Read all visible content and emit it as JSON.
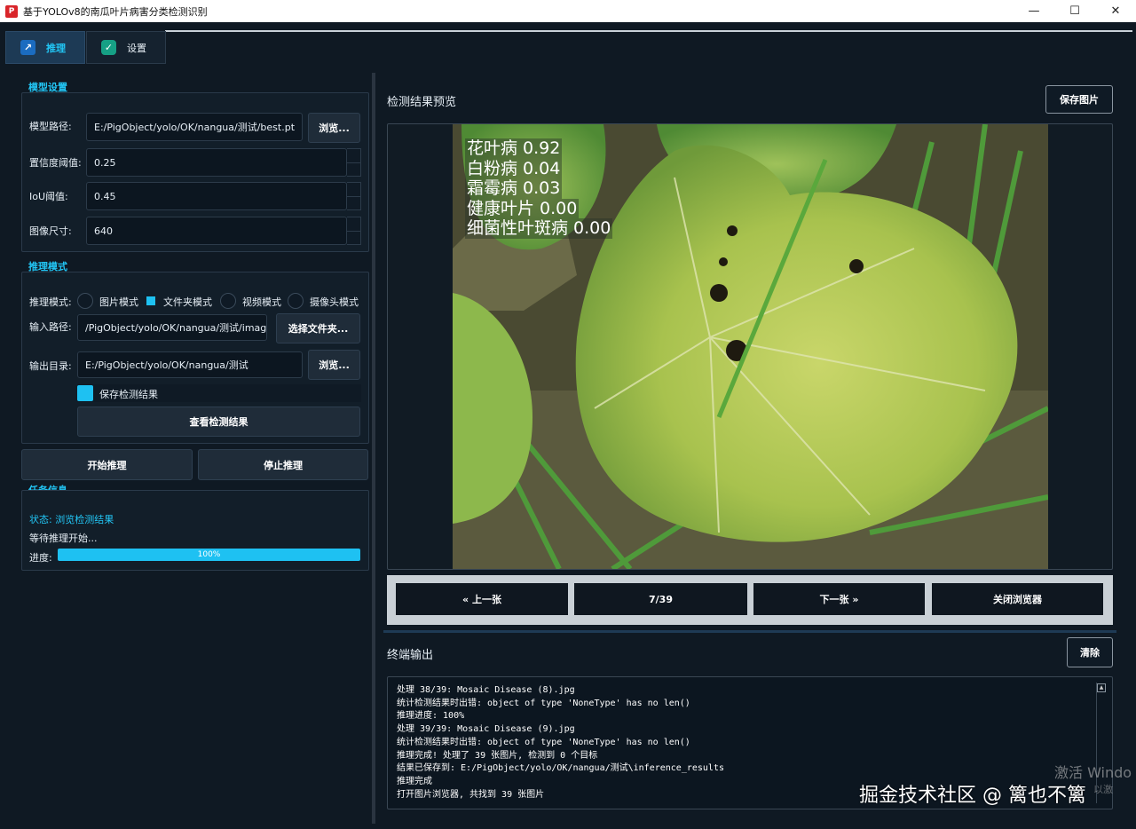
{
  "window": {
    "title": "基于YOLOv8的南瓜叶片病害分类检测识别",
    "minimize": "—",
    "maximize": "☐",
    "close": "✕"
  },
  "tabs": [
    {
      "label": "推理",
      "icon": "chart-icon",
      "active": true
    },
    {
      "label": "设置",
      "icon": "check-icon",
      "active": false
    }
  ],
  "model_settings": {
    "section_title": "模型设置",
    "model_path_label": "模型路径:",
    "model_path_value": "E:/PigObject/yolo/OK/nangua/测试/best.pt",
    "browse_label": "浏览...",
    "conf_label": "置信度阈值:",
    "conf_value": "0.25",
    "iou_label": "IoU阈值:",
    "iou_value": "0.45",
    "imgsz_label": "图像尺寸:",
    "imgsz_value": "640"
  },
  "inference_mode": {
    "section_title": "推理模式",
    "mode_label": "推理模式:",
    "modes": [
      "图片模式",
      "文件夹模式",
      "视频模式",
      "摄像头模式"
    ],
    "selected_mode": "文件夹模式",
    "input_label": "输入路径:",
    "input_value": "/PigObject/yolo/OK/nangua/测试/image",
    "select_folder_label": "选择文件夹...",
    "output_label": "输出目录:",
    "output_value": "E:/PigObject/yolo/OK/nangua/测试",
    "browse_label": "浏览...",
    "save_results_label": "保存检测结果",
    "save_results_checked": true,
    "view_results_label": "查看检测结果"
  },
  "actions": {
    "start_label": "开始推理",
    "stop_label": "停止推理"
  },
  "task_info": {
    "section_title": "任务信息",
    "status_text": "状态: 浏览检测结果",
    "waiting_text": "等待推理开始...",
    "progress_label": "进度:",
    "progress_value": 1.0,
    "progress_text": "100%"
  },
  "preview": {
    "title": "检测结果预览",
    "save_label": "保存图片",
    "detections": [
      "花叶病 0.92",
      "白粉病 0.04",
      "霜霉病 0.03",
      "健康叶片 0.00",
      "细菌性叶斑病 0.00"
    ]
  },
  "navigation": {
    "prev_label": "« 上一张",
    "counter": "7/39",
    "next_label": "下一张 »",
    "close_label": "关闭浏览器"
  },
  "terminal": {
    "title": "终端输出",
    "clear_label": "清除",
    "lines": [
      "处理 38/39: Mosaic Disease (8).jpg",
      "统计检测结果时出错: object of type 'NoneType' has no len()",
      "推理进度: 100%",
      "处理 39/39: Mosaic Disease (9).jpg",
      "统计检测结果时出错: object of type 'NoneType' has no len()",
      "推理完成! 处理了 39 张图片, 检测到 0 个目标",
      "结果已保存到: E:/PigObject/yolo/OK/nangua/测试\\inference_results",
      "推理完成",
      "打开图片浏览器, 共找到 39 张图片"
    ]
  },
  "overlays": {
    "windows_activation": "激活 Windo",
    "windows_activation_sub": "以激",
    "watermark": "掘金技术社区 @ 篱也不篱"
  },
  "colors": {
    "accent": "#1ec1f2",
    "background": "#0f1923"
  }
}
